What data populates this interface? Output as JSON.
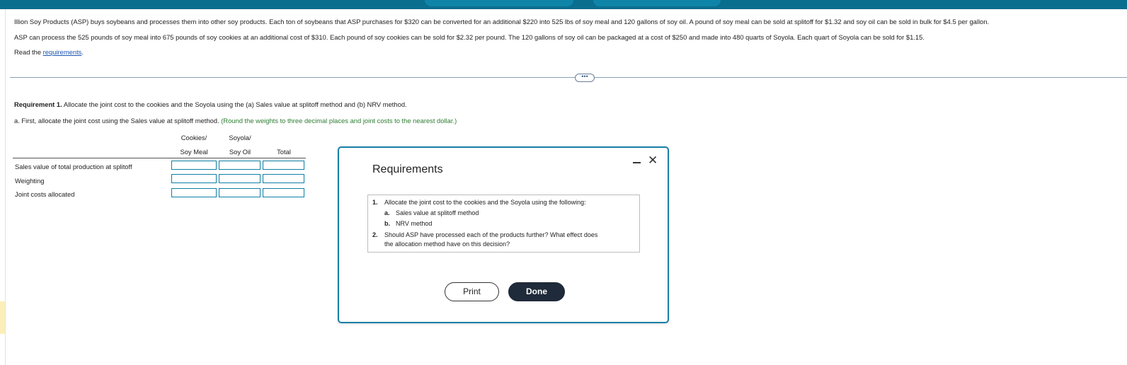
{
  "intro": {
    "line1": "Illion Soy Products (ASP) buys soybeans and processes them into other soy products. Each ton of soybeans that ASP purchases for $320 can be converted for an additional $220 into 525 lbs of soy meal and 120 gallons of soy oil. A pound of soy meal can be sold at splitoff for $1.32 and soy oil can be sold in bulk for $4.5 per gallon.",
    "line2": "ASP can process the 525 pounds of soy meal into 675 pounds of soy cookies at an additional cost of $310. Each pound of soy cookies can be sold for $2.32 per pound. The 120 gallons of soy oil can be packaged at a cost of $250 and made into 480 quarts of Soyola. Each quart of Soyola can be sold for $1.15.",
    "read_prefix": "Read the ",
    "read_link": "requirements",
    "read_suffix": "."
  },
  "more_button": "•••",
  "requirement1": {
    "label": "Requirement 1.",
    "text": " Allocate the joint cost to the cookies and the Soyola using the (a) Sales value at splitoff method and (b) NRV method."
  },
  "part_a": {
    "text": "a. First, allocate the joint cost using the Sales value at splitoff method. ",
    "hint": "(Round the weights to three decimal places and joint costs to the nearest dollar.)"
  },
  "table": {
    "col1_line1": "Cookies/",
    "col1_line2": "Soy Meal",
    "col2_line1": "Soyola/",
    "col2_line2": "Soy Oil",
    "col3": "Total",
    "rows": [
      "Sales value of total production at splitoff",
      "Weighting",
      "Joint costs allocated"
    ]
  },
  "modal": {
    "title": "Requirements",
    "items": [
      {
        "num": "1.",
        "text": "Allocate the joint cost to the cookies and the Soyola using the following:"
      },
      {
        "num": "a.",
        "text": "Sales value at splitoff method"
      },
      {
        "num": "b.",
        "text": "NRV method"
      },
      {
        "num": "2.",
        "text": "Should ASP have processed each of the products further? What effect does"
      },
      {
        "num": "",
        "text": "the allocation method have on this decision?"
      }
    ],
    "print_label": "Print",
    "done_label": "Done",
    "minimize_icon": "minimize-icon",
    "close_icon": "close-icon"
  },
  "colors": {
    "topbar": "#0a6e8f",
    "input_border": "#0e7fa6",
    "hint_green": "#2e7d32",
    "done_bg": "#1f2a3a"
  }
}
